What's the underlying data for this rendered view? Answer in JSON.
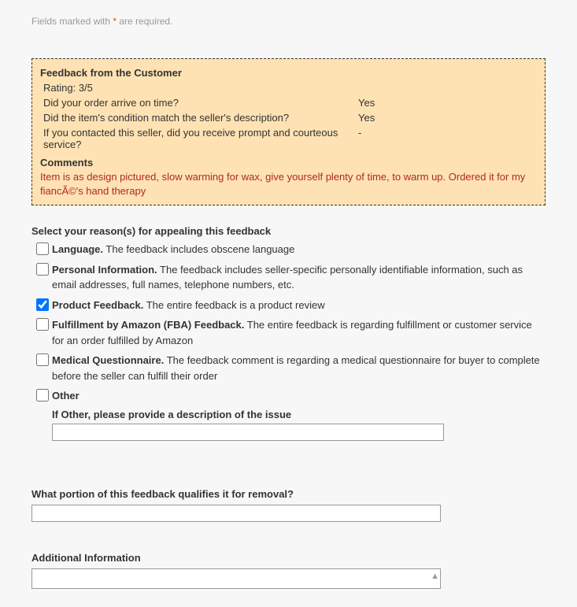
{
  "requiredNote": {
    "prefix": "Fields marked with ",
    "asterisk": "*",
    "suffix": " are required."
  },
  "feedback": {
    "heading": "Feedback from the Customer",
    "ratingLabel": "Rating: ",
    "ratingValue": "3/5",
    "qa": [
      {
        "q": "Did your order arrive on time?",
        "a": "Yes"
      },
      {
        "q": "Did the item's condition match the seller's description?",
        "a": "Yes"
      },
      {
        "q": "If you contacted this seller, did you receive prompt and courteous service?",
        "a": "-"
      }
    ],
    "commentsHead": "Comments",
    "commentsBody": "Item is as design pictured, slow warming for wax, give yourself plenty of time, to warm up. Ordered it for my fiancÃ©'s hand therapy"
  },
  "reasons": {
    "title": "Select your reason(s) for appealing this feedback",
    "options": [
      {
        "lead": "Language.",
        "desc": " The feedback includes obscene language",
        "checked": false
      },
      {
        "lead": "Personal Information.",
        "desc": " The feedback includes seller-specific personally identifiable information, such as email addresses, full names, telephone numbers, etc.",
        "checked": false
      },
      {
        "lead": "Product Feedback.",
        "desc": " The entire feedback is a product review",
        "checked": true
      },
      {
        "lead": "Fulfillment by Amazon (FBA) Feedback.",
        "desc": " The entire feedback is regarding fulfillment or customer service for an order fulfilled by Amazon",
        "checked": false
      },
      {
        "lead": "Medical Questionnaire.",
        "desc": " The feedback comment is regarding a medical questionnaire for buyer to complete before the seller can fulfill their order",
        "checked": false
      },
      {
        "lead": "Other",
        "desc": "",
        "checked": false
      }
    ],
    "otherLabel": "If Other, please provide a description of the issue",
    "otherValue": ""
  },
  "portion": {
    "label": "What portion of this feedback qualifies it for removal?",
    "value": ""
  },
  "additional": {
    "label": "Additional Information",
    "value": ""
  }
}
